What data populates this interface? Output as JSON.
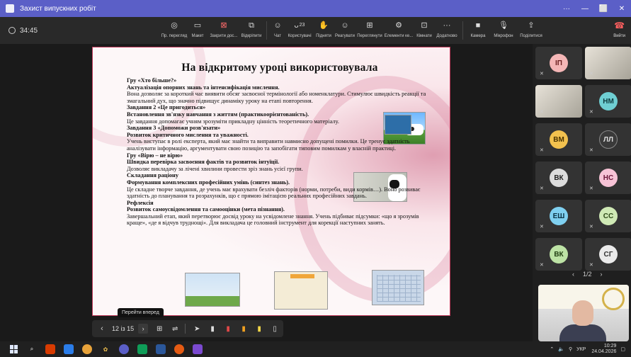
{
  "window": {
    "title": "Захист випускних робіт"
  },
  "toolbar": {
    "timer": "34:45",
    "items": [
      {
        "label": "Пр. перегляд",
        "icon": "preview-icon"
      },
      {
        "label": "Макет",
        "icon": "layout-icon"
      },
      {
        "label": "Закрити дос...",
        "icon": "stop-share-icon"
      },
      {
        "label": "Відкріпити",
        "icon": "unpin-icon"
      },
      {
        "label": "Чат",
        "icon": "chat-icon"
      },
      {
        "label": "Користувачі",
        "icon": "people-icon",
        "badge": "23"
      },
      {
        "label": "Підняти",
        "icon": "raise-hand-icon"
      },
      {
        "label": "Реагувати",
        "icon": "react-icon"
      },
      {
        "label": "Переглянути",
        "icon": "view-icon"
      },
      {
        "label": "Елементи ке...",
        "icon": "controls-icon"
      },
      {
        "label": "Кімнати",
        "icon": "rooms-icon"
      },
      {
        "label": "Додатково",
        "icon": "more-icon"
      }
    ],
    "camera_label": "Камера",
    "mic_label": "Мікрофон",
    "share_label": "Поділитися",
    "leave_label": "Вийти"
  },
  "slide": {
    "title": "На відкритому уроці використовувала",
    "lines": [
      {
        "text": "Гру «Хто більше?»",
        "bold": true
      },
      {
        "text": "Актуалізація опорних знань та інтенсифікація мислення.",
        "bold": true
      },
      {
        "text": "Вона дозволяє за короткий час виявити обсяг засвоєної термінології або номенклатури. Стимулює швидкість реакції та змагальний дух, що значно підвищує динаміку уроку на етапі повторення.",
        "bold": false
      },
      {
        "text": " Завдання 2 «Це пригодиться»",
        "bold": true
      },
      {
        "text": "  Встановлення зв'язку навчання з життям (практикоорієнтованість).",
        "bold": true
      },
      {
        "text": " Це завдання допомагає учням зрозуміти прикладну цінність теоретичного матеріалу.",
        "bold": false
      },
      {
        "text": "Завдання 3 «Допоможи розв'язати»",
        "bold": true
      },
      {
        "text": "Розвиток критичного мислення та уважності.",
        "bold": true
      },
      {
        "text": "Учень виступає в ролі експерта, який має знайти та виправити навмисно допущені помилки. Це тренує здатність аналізувати інформацію, аргументувати свою позицію та запобігати типовим помилкам у власній практиці.",
        "bold": false
      },
      {
        "text": "Гру «Вірю – не вірю»",
        "bold": true
      },
      {
        "text": "Швидка перевірка засвоєння фактів та розвиток інтуїції.",
        "bold": true
      },
      {
        "text": "Дозволяє викладачу за лічені хвилини провести зріз знань усієї групи.",
        "bold": false
      },
      {
        "text": "Складання раціону",
        "bold": true
      },
      {
        "text": "Формування комплексних професійних умінь (синтез знань).",
        "bold": true
      },
      {
        "text": "Це складне творче завдання, де учень має врахувати безліч факторів (норми, потреби, види кормів…). Воно розвиває здатність до планування та розрахунків, що є прямою імітацією реальних професійних завдань.",
        "bold": false
      },
      {
        "text": "Рефлексія",
        "bold": true
      },
      {
        "text": "Розвиток самоусвідомлення та самооцінки (мета пізнання).",
        "bold": true
      },
      {
        "text": "Завершальний етап, який перетворює досвід уроку на усвідомлене знання. Учень підбиває підсумки: «що я зрозумів краще», «де я відчув труднощі». Для викладача це головний інструмент для корекції наступних занять.",
        "bold": false
      }
    ]
  },
  "presenter": {
    "counter": "12 із 15",
    "tooltip": "Перейти вперед"
  },
  "participants": [
    {
      "initials": "ІП",
      "color": "#f4b6b6",
      "text_color": "#6a1f1f"
    },
    {
      "initials": "НМ",
      "color": "#6fcfd3",
      "text_color": "#0f3d40"
    },
    {
      "initials": "ВМ",
      "color": "#f2c14e",
      "text_color": "#4a3300"
    },
    {
      "initials": "ЛЛ",
      "color": "#3a3a3a",
      "text_color": "#dddddd"
    },
    {
      "initials": "ВК",
      "color": "#dcdcdc",
      "text_color": "#222222"
    },
    {
      "initials": "НС",
      "color": "#f7c3d6",
      "text_color": "#6b1538"
    },
    {
      "initials": "ЕШ",
      "color": "#7fd0f0",
      "text_color": "#0a3244"
    },
    {
      "initials": "СС",
      "color": "#cfe9b5",
      "text_color": "#2e4a18"
    },
    {
      "initials": "ВК",
      "color": "#bde3a5",
      "text_color": "#224013"
    },
    {
      "initials": "СГ",
      "color": "#eaeaea",
      "text_color": "#333333"
    }
  ],
  "pager": {
    "label": "1/2"
  },
  "taskbar": {
    "lang": "УКР",
    "time": "10:29",
    "date": "24.04.2026"
  },
  "colors": {
    "teams_purple": "#5b5fc7",
    "slide_border": "#c23a5b"
  }
}
